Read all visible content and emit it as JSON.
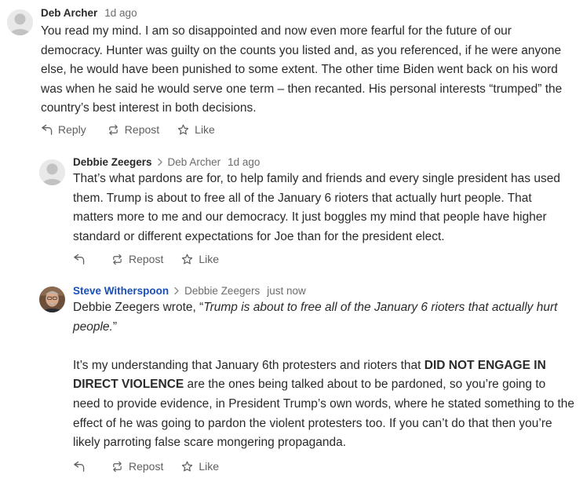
{
  "comments": [
    {
      "author": "Deb Archer",
      "reply_to": "",
      "time": "1d ago",
      "paragraphs": [
        [
          {
            "t": "You read my mind. I am so disappointed and now even more fearful for the future of our democracy. Hunter was guilty on the counts you listed and, as you referenced, if he were anyone else, he would have been punished to some extent. The other time Biden went back on his word was when he said he would serve one term – then recanted. His personal interests “trumped” the country’s best interest in both decisions."
          }
        ]
      ],
      "actions": {
        "reply": "Reply",
        "repost": "Repost",
        "like": "Like"
      }
    },
    {
      "author": "Debbie Zeegers",
      "reply_to": "Deb Archer",
      "time": "1d ago",
      "paragraphs": [
        [
          {
            "t": "That’s what pardons are for, to help family and friends and every single president has used them. Trump is about to free all of the January 6 rioters that actually hurt people. That matters more to me and our democracy. It just boggles my mind that people have higher standard or different expectations for Joe than for the president elect."
          }
        ]
      ],
      "actions": {
        "reply": "",
        "repost": "Repost",
        "like": "Like"
      }
    },
    {
      "author": "Steve Witherspoon",
      "reply_to": "Debbie Zeegers",
      "time": "just now",
      "paragraphs": [
        [
          {
            "t": "Debbie Zeegers wrote, “"
          },
          {
            "t": "Trump is about to free all of the January 6 rioters that actually hurt people.",
            "i": true
          },
          {
            "t": "”"
          }
        ],
        [
          {
            "t": "It’s my understanding that January 6th protesters and rioters that "
          },
          {
            "t": "DID NOT ENGAGE IN DIRECT VIOLENCE",
            "b": true
          },
          {
            "t": " are the ones being talked about to be pardoned, so you’re going to need to provide evidence, in President Trump’s own words, where he stated something to the effect of he was going to pardon the violent protesters too. If you can’t do that then you’re likely parroting false scare mongering propaganda."
          }
        ]
      ],
      "actions": {
        "reply": "",
        "repost": "Repost",
        "like": "Like"
      }
    }
  ],
  "colors": {
    "author_default": "#292929",
    "author_highlight": "#1a4fb8",
    "muted": "#6b6b6b",
    "body": "#2a2a2a"
  },
  "icons": {
    "reply": "reply-arrow-icon",
    "repost": "repost-icon",
    "like": "star-icon",
    "chevron": "chevron-right-icon",
    "avatar_default": "default-avatar-icon"
  }
}
